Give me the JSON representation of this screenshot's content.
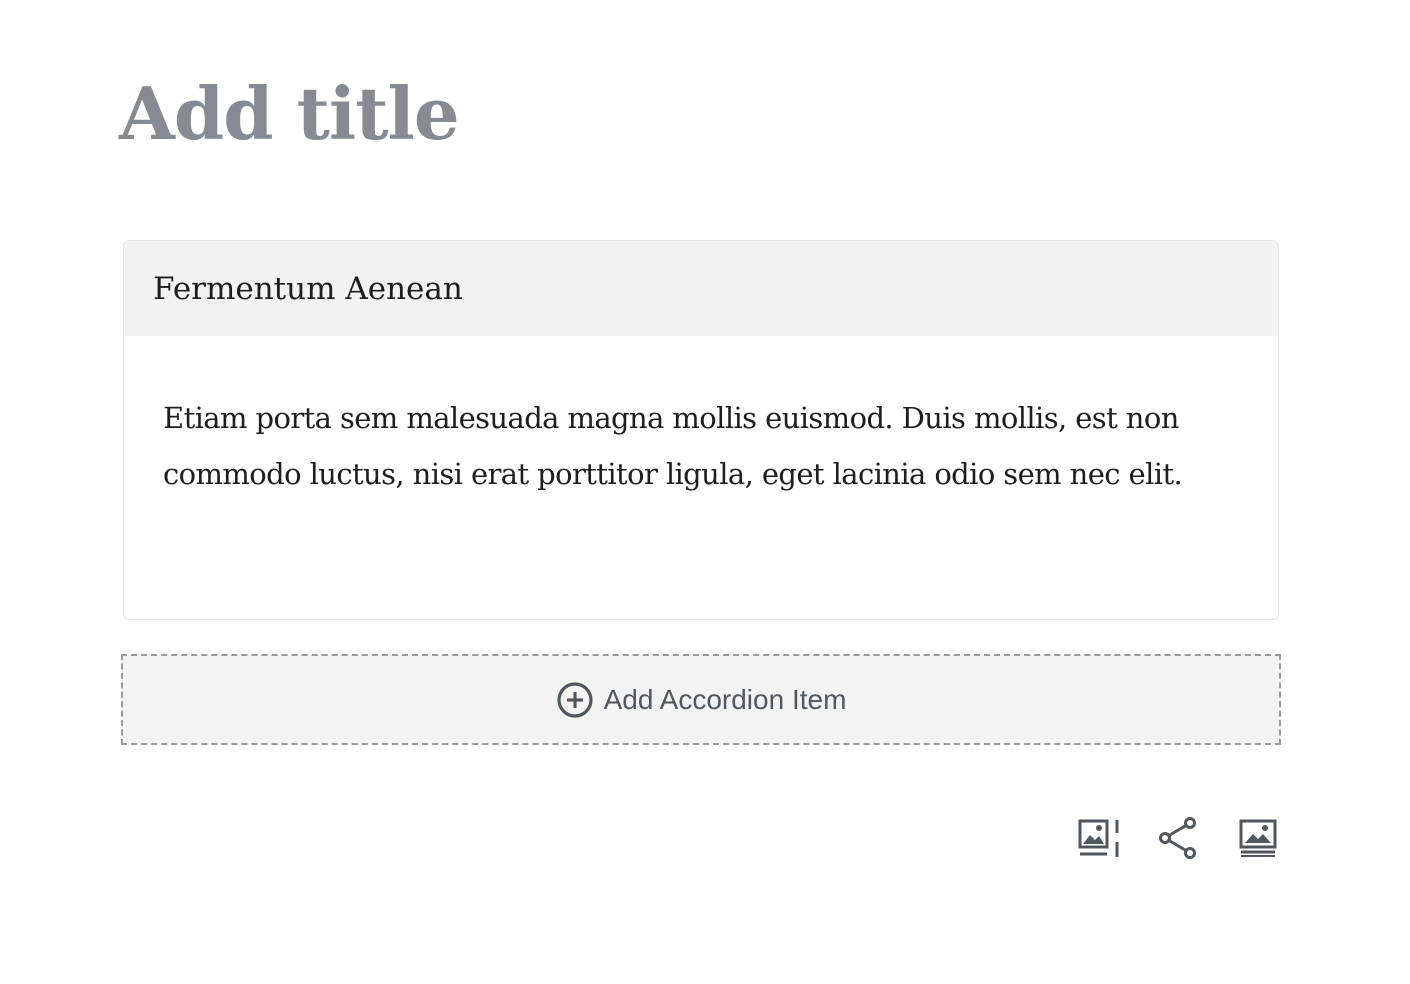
{
  "page": {
    "title_placeholder": "Add title"
  },
  "accordion": {
    "item_title": "Fermentum Aenean",
    "item_content": "Etiam porta sem malesuada magna mollis euismod. Duis mollis, est non commodo luctus, nisi erat porttitor ligula, eget lacinia odio sem nec elit."
  },
  "add_item": {
    "label": "Add Accordion Item",
    "icon": "plus-circle-icon"
  },
  "toolbar": {
    "icons": [
      "media-text-icon",
      "share-icon",
      "cover-image-icon"
    ]
  },
  "colors": {
    "title": "#858a93",
    "header_bg": "#f2f2f2",
    "text": "#1e1e1e",
    "icon": "#50575e"
  }
}
